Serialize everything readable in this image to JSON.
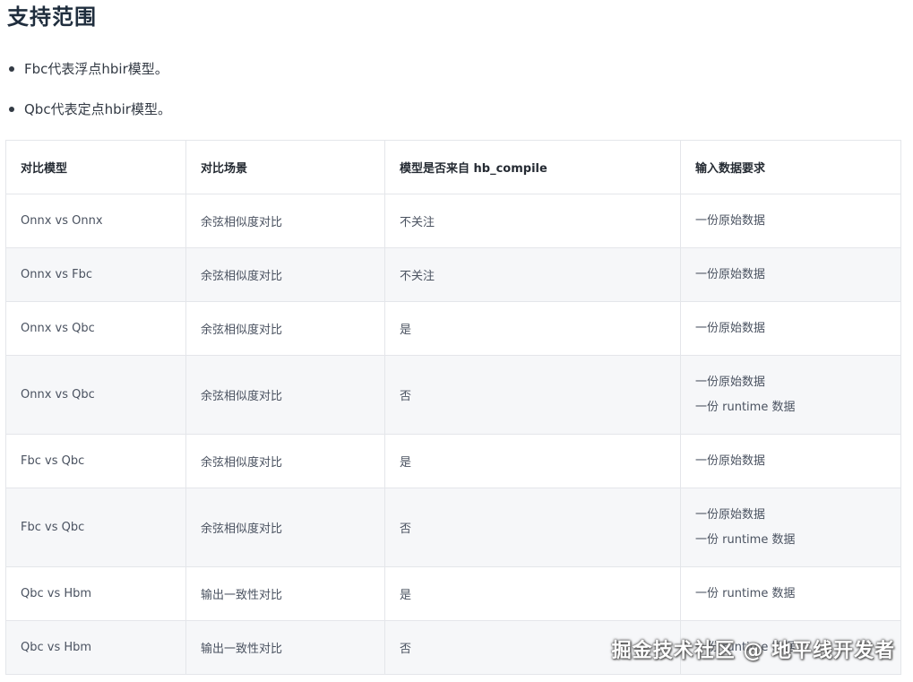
{
  "heading": "支持范围",
  "bullets": [
    "Fbc代表浮点hbir模型。",
    "Qbc代表定点hbir模型。"
  ],
  "table": {
    "headers": [
      "对比模型",
      "对比场景",
      "模型是否来自 hb_compile",
      "输入数据要求"
    ],
    "rows": [
      {
        "model": "Onnx vs Onnx",
        "scene": "余弦相似度对比",
        "from_compile": "不关注",
        "input": [
          "一份原始数据"
        ]
      },
      {
        "model": "Onnx vs Fbc",
        "scene": "余弦相似度对比",
        "from_compile": "不关注",
        "input": [
          "一份原始数据"
        ]
      },
      {
        "model": "Onnx vs Qbc",
        "scene": "余弦相似度对比",
        "from_compile": "是",
        "input": [
          "一份原始数据"
        ]
      },
      {
        "model": "Onnx vs Qbc",
        "scene": "余弦相似度对比",
        "from_compile": "否",
        "input": [
          "一份原始数据",
          "一份 runtime 数据"
        ]
      },
      {
        "model": "Fbc vs Qbc",
        "scene": "余弦相似度对比",
        "from_compile": "是",
        "input": [
          "一份原始数据"
        ]
      },
      {
        "model": "Fbc vs Qbc",
        "scene": "余弦相似度对比",
        "from_compile": "否",
        "input": [
          "一份原始数据",
          "一份 runtime 数据"
        ]
      },
      {
        "model": "Qbc vs Hbm",
        "scene": "输出一致性对比",
        "from_compile": "是",
        "input": [
          "一份 runtime 数据"
        ]
      },
      {
        "model": "Qbc vs Hbm",
        "scene": "输出一致性对比",
        "from_compile": "否",
        "input": [
          "一份 runtime 数据"
        ]
      }
    ]
  },
  "watermark": "掘金技术社区 @ 地平线开发者"
}
